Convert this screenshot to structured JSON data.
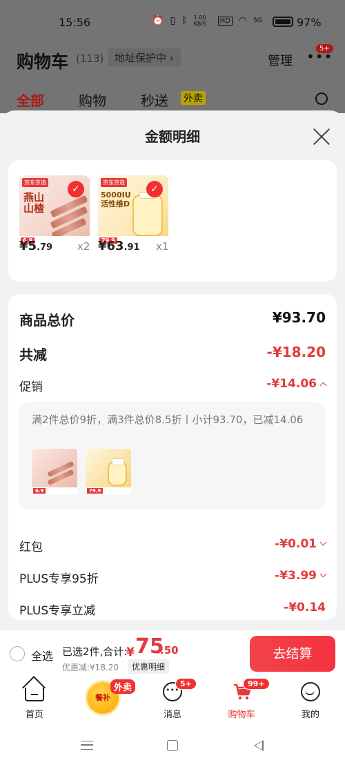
{
  "status": {
    "time": "15:56",
    "speed": "1.00 KB/S",
    "network": "5G",
    "battery": "97%"
  },
  "bg": {
    "title": "购物车",
    "count": "(113)",
    "address": "地址保护中 ›",
    "manage": "管理",
    "more_badge": "5+",
    "tabs": [
      "全部",
      "购物",
      "秒送"
    ],
    "waimai": "外卖"
  },
  "sheet": {
    "title": "金额明细",
    "products": [
      {
        "brand": "京东京造",
        "name": "燕山山楂",
        "strip": "6.9",
        "price_int": "¥5",
        "price_dec": ".79",
        "qty": "x2"
      },
      {
        "brand": "京东京造",
        "name": "5000IU活性维D",
        "strip": "79.9",
        "price_int": "¥63",
        "price_dec": ".91",
        "qty": "x1"
      }
    ],
    "summary": {
      "total_label": "商品总价",
      "total_value": "¥93.70",
      "reduce_label": "共减",
      "reduce_value": "-¥18.20",
      "promo_label": "促销",
      "promo_value": "-¥14.06",
      "promo_desc": "满2件总价9折，满3件总价8.5折丨小计93.70，已减14.06",
      "redpack_label": "红包",
      "redpack_value": "-¥0.01",
      "plus95_label": "PLUS专享95折",
      "plus95_value": "-¥3.99",
      "plusm_label": "PLUS专享立减",
      "plusm_value": "-¥0.14"
    }
  },
  "checkout": {
    "select_all": "全选",
    "selected": "已选2件,合计:",
    "yen": "¥",
    "total_int": "75",
    "total_dec": ".50",
    "discount": "优惠减:¥18.20",
    "detail": "优惠明细",
    "pay": "去结算"
  },
  "nav": {
    "home": "首页",
    "canbu": "餐补",
    "waimai_tag": "外卖",
    "msg": "消息",
    "msg_badge": "5+",
    "cart": "购物车",
    "cart_badge": "99+",
    "me": "我的"
  },
  "colors": {
    "accent": "#e4393c",
    "pay_button": "#f23030"
  }
}
